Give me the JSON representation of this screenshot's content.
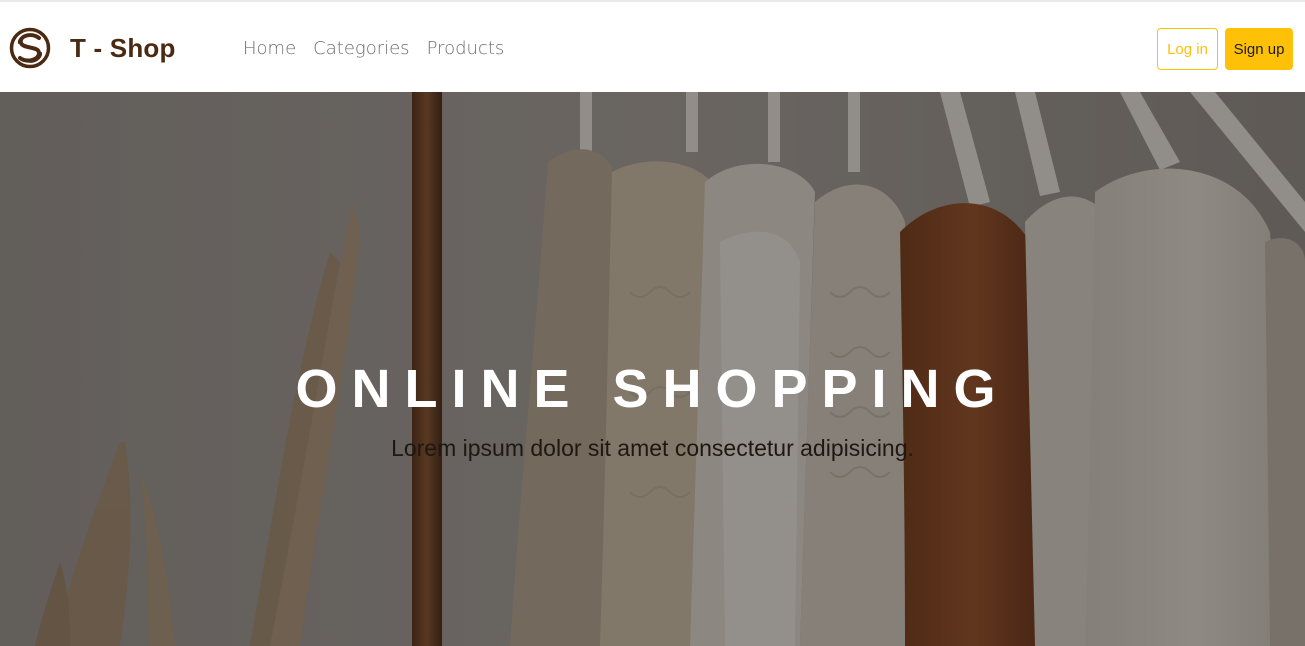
{
  "header": {
    "brand_name": "T - Shop",
    "logo_icon": "s-swirl-logo-icon",
    "nav": [
      {
        "label": "Home"
      },
      {
        "label": "Categories"
      },
      {
        "label": "Products"
      }
    ],
    "login_label": "Log in",
    "signup_label": "Sign up"
  },
  "hero": {
    "title": "ONLINE SHOPPING",
    "subtitle": "Lorem ipsum dolor sit amet consectetur adipisicing.",
    "background": "clothing-rack-photo"
  },
  "colors": {
    "brand_brown": "#4a2a12",
    "accent_yellow": "#ffc107",
    "nav_gray": "#6d6d6d"
  }
}
